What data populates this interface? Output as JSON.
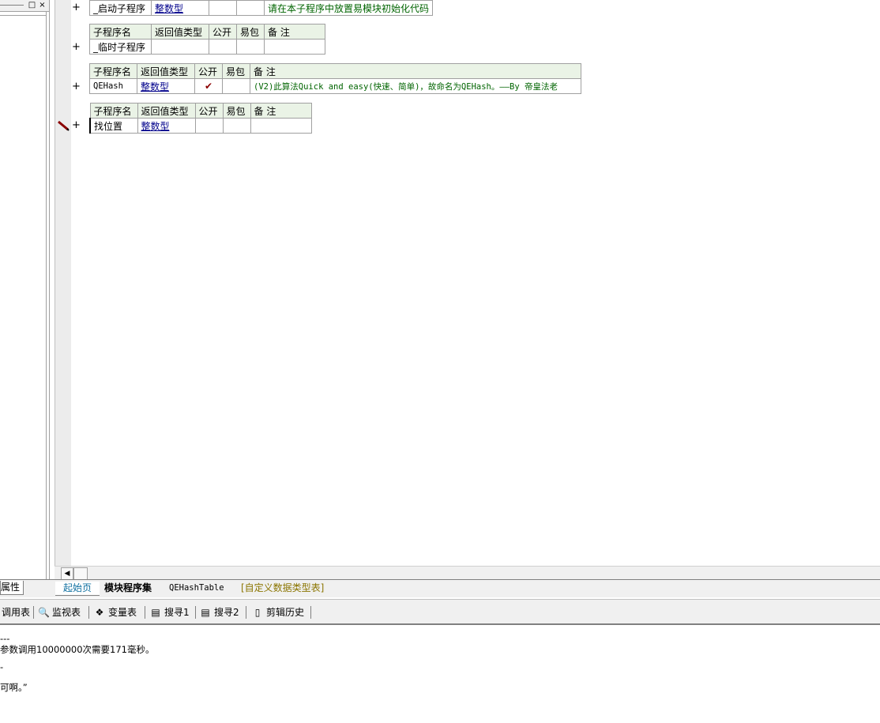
{
  "left_panel": {
    "max_label": "□",
    "close_label": "×",
    "bottom_tab": "属性"
  },
  "tables": [
    {
      "row": {
        "name": "_启动子程序",
        "type": "整数型",
        "public": "",
        "pack": "",
        "remark": "请在本子程序中放置易模块初始化代码"
      }
    },
    {
      "headers": [
        "子程序名",
        "返回值类型",
        "公开",
        "易包",
        "备 注"
      ],
      "row": {
        "name": "_临时子程序",
        "type": "",
        "public": "",
        "pack": "",
        "remark": ""
      }
    },
    {
      "headers": [
        "子程序名",
        "返回值类型",
        "公开",
        "易包",
        "备 注"
      ],
      "row": {
        "name": "QEHash",
        "type": "整数型",
        "public": "✔",
        "pack": "",
        "remark": "(V2)此算法Quick and easy(快速、简单)，故命名为QEHash。——By 帝皇法老"
      }
    },
    {
      "headers": [
        "子程序名",
        "返回值类型",
        "公开",
        "易包",
        "备 注"
      ],
      "row": {
        "name": "找位置",
        "type": "整数型",
        "public": "",
        "pack": "",
        "remark": ""
      }
    }
  ],
  "gutter": {
    "plus": "+"
  },
  "tabs": [
    "起始页",
    "模块程序集",
    "QEHashTable",
    "[自定义数据类型表]"
  ],
  "toolbar": [
    {
      "label": "调用表",
      "icon": "call-table-icon"
    },
    {
      "label": "监视表",
      "icon": "magnifier-icon",
      "glyph": "🔍"
    },
    {
      "label": "变量表",
      "icon": "variable-icon",
      "glyph": "❖"
    },
    {
      "label": "搜寻1",
      "icon": "search1-icon",
      "glyph": "▤"
    },
    {
      "label": "搜寻2",
      "icon": "search2-icon",
      "glyph": "▤"
    },
    {
      "label": "剪辑历史",
      "icon": "clip-history-icon",
      "glyph": "▯"
    }
  ],
  "output": [
    "---",
    "参数调用10000000次需要171毫秒。",
    "-",
    "",
    "可啊。”"
  ],
  "colors": {
    "header_bg": "#eaf3e6",
    "link": "#00008b",
    "remark": "#006400"
  }
}
